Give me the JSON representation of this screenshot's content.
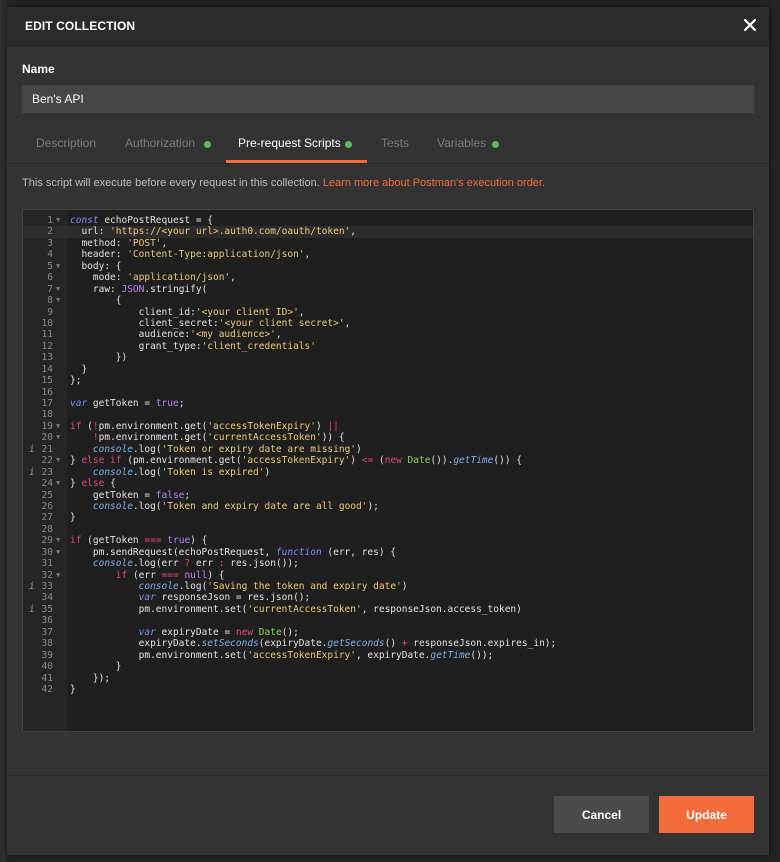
{
  "modal": {
    "title": "EDIT COLLECTION",
    "close_glyph": "×"
  },
  "form": {
    "name_label": "Name",
    "name_value": "Ben's API"
  },
  "tabs": [
    {
      "label": "Description",
      "active": false,
      "dot": false
    },
    {
      "label": "Authorization",
      "active": false,
      "dot": true
    },
    {
      "label": "Pre-request Scripts",
      "active": true,
      "dot": true
    },
    {
      "label": "Tests",
      "active": false,
      "dot": false
    },
    {
      "label": "Variables",
      "active": false,
      "dot": true
    }
  ],
  "hint": {
    "text": "This script will execute before every request in this collection.",
    "link": "Learn more about Postman's execution order."
  },
  "editor": {
    "current_line": 2,
    "lines": [
      {
        "n": "1",
        "fold": true,
        "info": false,
        "html": "<span class=\"k\">const</span> echoPostRequest = {"
      },
      {
        "n": "2",
        "fold": false,
        "info": false,
        "html": "  url: <span class=\"s\">'https://&lt;your url&gt;.auth0.com/oauth/token'</span>,"
      },
      {
        "n": "3",
        "fold": false,
        "info": false,
        "html": "  method: <span class=\"s\">'POST'</span>,"
      },
      {
        "n": "4",
        "fold": false,
        "info": false,
        "html": "  header: <span class=\"s\">'Content-Type:application/json'</span>,"
      },
      {
        "n": "5",
        "fold": true,
        "info": false,
        "html": "  body: {"
      },
      {
        "n": "6",
        "fold": false,
        "info": false,
        "html": "    mode: <span class=\"s\">'application/json'</span>,"
      },
      {
        "n": "7",
        "fold": true,
        "info": false,
        "html": "    raw: <span class=\"b\">JSON</span>.stringify("
      },
      {
        "n": "8",
        "fold": true,
        "info": false,
        "html": "        {"
      },
      {
        "n": "9",
        "fold": false,
        "info": false,
        "html": "            client_id:<span class=\"s\">'&lt;your client ID&gt;'</span>,"
      },
      {
        "n": "10",
        "fold": false,
        "info": false,
        "html": "            client_secret:<span class=\"s\">'&lt;your client secret&gt;'</span>,"
      },
      {
        "n": "11",
        "fold": false,
        "info": false,
        "html": "            audience:<span class=\"s\">'&lt;my audience&gt;'</span>,"
      },
      {
        "n": "12",
        "fold": false,
        "info": false,
        "html": "            grant_type:<span class=\"s\">'client_credentials'</span>"
      },
      {
        "n": "13",
        "fold": false,
        "info": false,
        "html": "        })"
      },
      {
        "n": "14",
        "fold": false,
        "info": false,
        "html": "  }"
      },
      {
        "n": "15",
        "fold": false,
        "info": false,
        "html": "};"
      },
      {
        "n": "16",
        "fold": false,
        "info": false,
        "html": ""
      },
      {
        "n": "17",
        "fold": false,
        "info": false,
        "html": "<span class=\"k\">var</span> getToken = <span class=\"b\">true</span>;"
      },
      {
        "n": "18",
        "fold": false,
        "info": false,
        "html": ""
      },
      {
        "n": "19",
        "fold": true,
        "info": false,
        "html": "<span class=\"o\">if</span> (<span class=\"o\">!</span>pm.environment.get(<span class=\"s\">'accessTokenExpiry'</span>) <span class=\"o\">||</span>"
      },
      {
        "n": "20",
        "fold": true,
        "info": false,
        "html": "    <span class=\"o\">!</span>pm.environment.get(<span class=\"s\">'currentAccessToken'</span>)) {"
      },
      {
        "n": "21",
        "fold": false,
        "info": true,
        "html": "    <span class=\"cm\">console</span>.log(<span class=\"s\">'Token or expiry date are missing'</span>)"
      },
      {
        "n": "22",
        "fold": true,
        "info": false,
        "html": "} <span class=\"o\">else if</span> (pm.environment.get(<span class=\"s\">'accessTokenExpiry'</span>) <span class=\"o\">&lt;=</span> (<span class=\"o\">new</span> <span class=\"g\">Date</span>()).<span class=\"cm\">getTime</span>()) {"
      },
      {
        "n": "23",
        "fold": false,
        "info": true,
        "html": "    <span class=\"cm\">console</span>.log(<span class=\"s\">'Token is expired'</span>)"
      },
      {
        "n": "24",
        "fold": true,
        "info": false,
        "html": "} <span class=\"o\">else</span> {"
      },
      {
        "n": "25",
        "fold": false,
        "info": false,
        "html": "    getToken = <span class=\"b\">false</span>;"
      },
      {
        "n": "26",
        "fold": false,
        "info": false,
        "html": "    <span class=\"cm\">console</span>.log(<span class=\"s\">'Token and expiry date are all good'</span>);"
      },
      {
        "n": "27",
        "fold": false,
        "info": false,
        "html": "}"
      },
      {
        "n": "28",
        "fold": false,
        "info": false,
        "html": ""
      },
      {
        "n": "29",
        "fold": true,
        "info": false,
        "html": "<span class=\"o\">if</span> (getToken <span class=\"o\">===</span> <span class=\"b\">true</span>) {"
      },
      {
        "n": "30",
        "fold": true,
        "info": false,
        "html": "    pm.sendRequest(echoPostRequest, <span class=\"k\">function</span> (err, res) {"
      },
      {
        "n": "31",
        "fold": false,
        "info": false,
        "html": "    <span class=\"cm\">console</span>.log(err <span class=\"o\">?</span> err <span class=\"o\">:</span> res.json());"
      },
      {
        "n": "32",
        "fold": true,
        "info": false,
        "html": "        <span class=\"o\">if</span> (err <span class=\"o\">===</span> <span class=\"b\">null</span>) {"
      },
      {
        "n": "33",
        "fold": false,
        "info": true,
        "html": "            <span class=\"cm\">console</span>.log(<span class=\"s\">'Saving the token and expiry date'</span>)"
      },
      {
        "n": "34",
        "fold": false,
        "info": false,
        "html": "            <span class=\"k\">var</span> responseJson = res.json();"
      },
      {
        "n": "35",
        "fold": false,
        "info": true,
        "html": "            pm.environment.set(<span class=\"s\">'currentAccessToken'</span>, responseJson.access_token)"
      },
      {
        "n": "36",
        "fold": false,
        "info": false,
        "html": ""
      },
      {
        "n": "37",
        "fold": false,
        "info": false,
        "html": "            <span class=\"k\">var</span> expiryDate = <span class=\"o\">new</span> <span class=\"g\">Date</span>();"
      },
      {
        "n": "38",
        "fold": false,
        "info": false,
        "html": "            expiryDate.<span class=\"cm\">setSeconds</span>(expiryDate.<span class=\"cm\">getSeconds</span>() <span class=\"o\">+</span> responseJson.expires_in);"
      },
      {
        "n": "39",
        "fold": false,
        "info": false,
        "html": "            pm.environment.set(<span class=\"s\">'accessTokenExpiry'</span>, expiryDate.<span class=\"cm\">getTime</span>());"
      },
      {
        "n": "40",
        "fold": false,
        "info": false,
        "html": "        }"
      },
      {
        "n": "41",
        "fold": false,
        "info": false,
        "html": "    });"
      },
      {
        "n": "42",
        "fold": false,
        "info": false,
        "html": "}"
      }
    ]
  },
  "footer": {
    "cancel_label": "Cancel",
    "update_label": "Update"
  },
  "colors": {
    "accent": "#f26b3a",
    "status_dot": "#5cb85c",
    "modal_bg": "#333333"
  }
}
